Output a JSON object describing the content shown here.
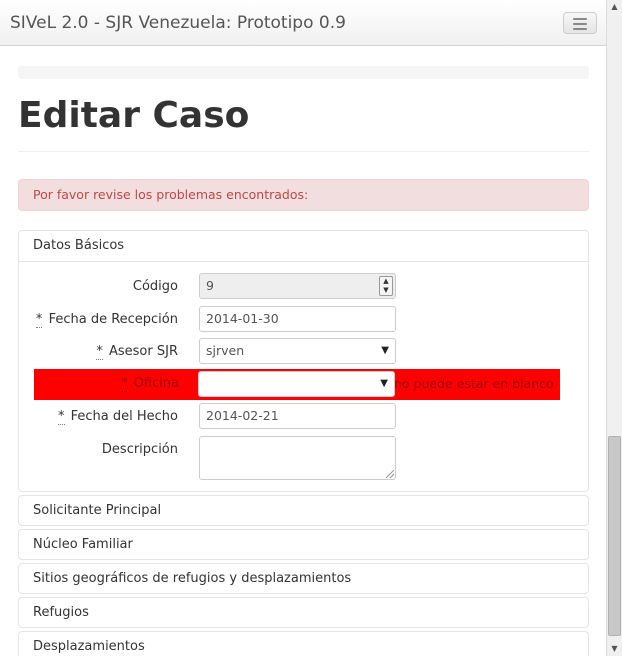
{
  "navbar": {
    "brand": "SIVeL 2.0 - SJR Venezuela: Prototipo 0.9"
  },
  "page": {
    "title": "Editar Caso"
  },
  "alert": {
    "message": "Por favor revise los problemas encontrados:"
  },
  "datos_basicos": {
    "heading": "Datos Básicos",
    "codigo": {
      "label": "Código",
      "value": "9"
    },
    "fecha_recepcion": {
      "required_mark": "*",
      "label": "Fecha de Recepción",
      "value": "2014-01-30"
    },
    "asesor": {
      "required_mark": "*",
      "label": "Asesor SJR",
      "value": "sjrven"
    },
    "oficina": {
      "required_mark": "*",
      "label": "Oficina",
      "value": "",
      "error": "no puede estar en blanco"
    },
    "fecha_hecho": {
      "required_mark": "*",
      "label": "Fecha del Hecho",
      "value": "2014-02-21"
    },
    "descripcion": {
      "label": "Descripción",
      "value": ""
    }
  },
  "sections": [
    {
      "label": "Solicitante Principal"
    },
    {
      "label": "Núcleo Familiar"
    },
    {
      "label": "Sitios geográficos de refugios y desplazamientos"
    },
    {
      "label": "Refugios"
    },
    {
      "label": "Desplazamientos"
    }
  ],
  "colors": {
    "error_background": "#ff0000",
    "alert_background": "#f2dede",
    "alert_text": "#b94a48"
  }
}
